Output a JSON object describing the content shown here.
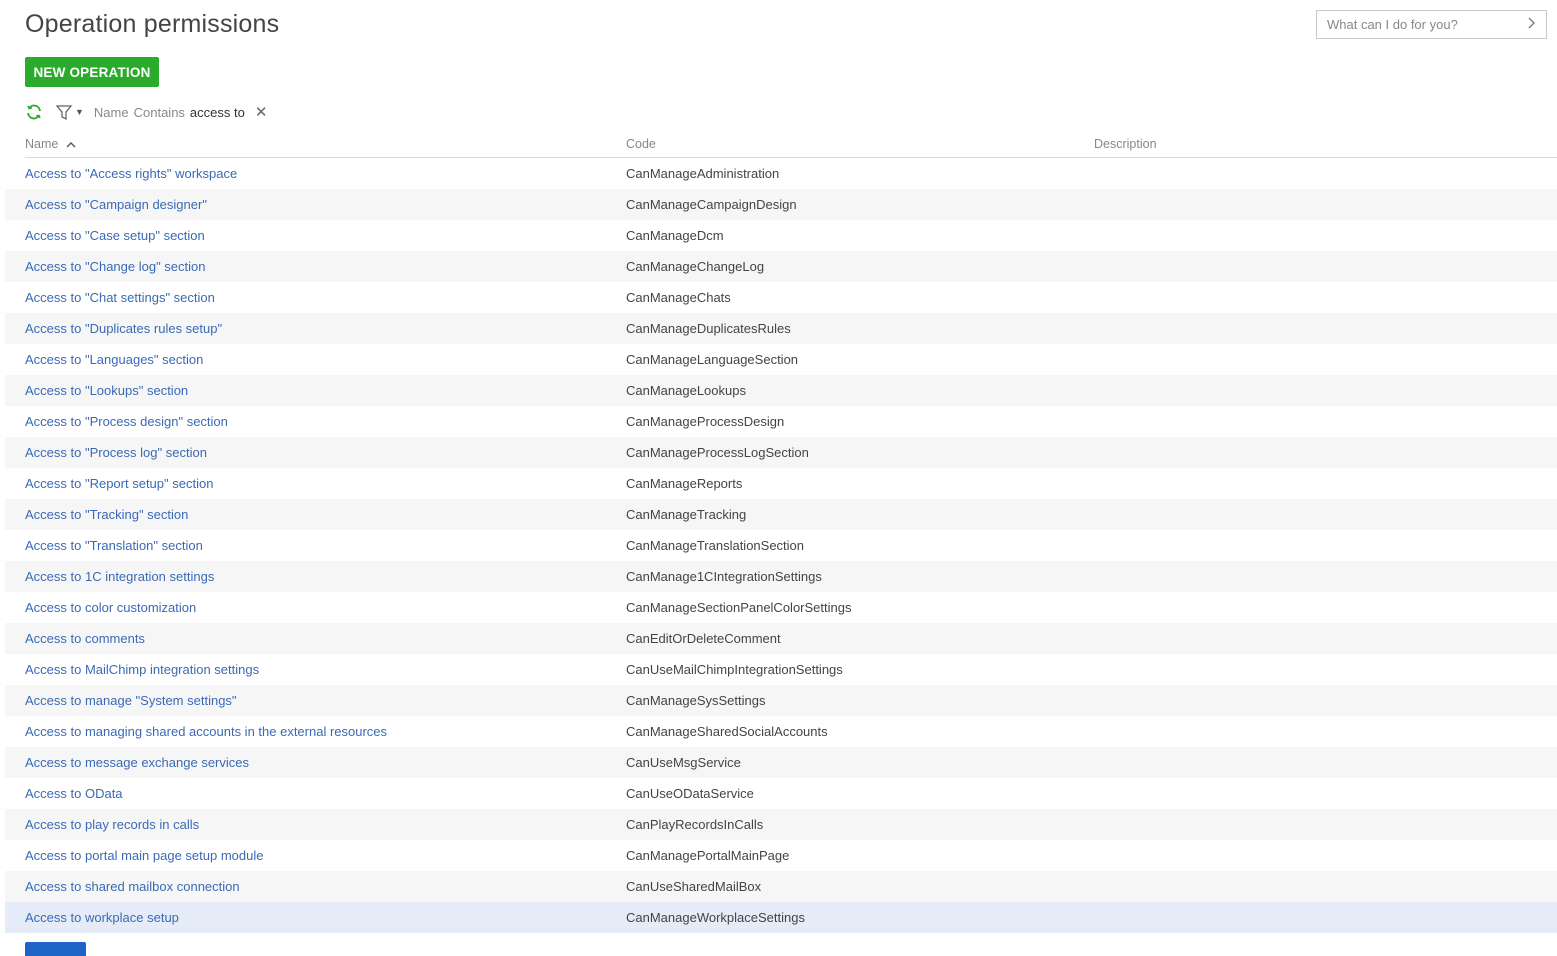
{
  "page": {
    "title": "Operation permissions"
  },
  "command": {
    "placeholder": "What can I do for you?"
  },
  "toolbar": {
    "new_label": "NEW OPERATION"
  },
  "filter": {
    "column": "Name",
    "operator": "Contains",
    "value": "access to"
  },
  "table": {
    "columns": [
      "Name",
      "Code",
      "Description"
    ],
    "rows": [
      {
        "name": "Access to \"Access rights\" workspace",
        "code": "CanManageAdministration",
        "description": ""
      },
      {
        "name": "Access to \"Campaign designer\"",
        "code": "CanManageCampaignDesign",
        "description": ""
      },
      {
        "name": "Access to \"Case setup\" section",
        "code": "CanManageDcm",
        "description": ""
      },
      {
        "name": "Access to \"Change log\" section",
        "code": "CanManageChangeLog",
        "description": ""
      },
      {
        "name": "Access to \"Chat settings\" section",
        "code": "CanManageChats",
        "description": ""
      },
      {
        "name": "Access to \"Duplicates rules setup\"",
        "code": "CanManageDuplicatesRules",
        "description": ""
      },
      {
        "name": "Access to \"Languages\" section",
        "code": "CanManageLanguageSection",
        "description": ""
      },
      {
        "name": "Access to \"Lookups\" section",
        "code": "CanManageLookups",
        "description": ""
      },
      {
        "name": "Access to \"Process design\" section",
        "code": "CanManageProcessDesign",
        "description": ""
      },
      {
        "name": "Access to \"Process log\" section",
        "code": "CanManageProcessLogSection",
        "description": ""
      },
      {
        "name": "Access to \"Report setup\" section",
        "code": "CanManageReports",
        "description": ""
      },
      {
        "name": "Access to \"Tracking\" section",
        "code": "CanManageTracking",
        "description": ""
      },
      {
        "name": "Access to \"Translation\" section",
        "code": "CanManageTranslationSection",
        "description": ""
      },
      {
        "name": "Access to 1C integration settings",
        "code": "CanManage1CIntegrationSettings",
        "description": ""
      },
      {
        "name": "Access to color customization",
        "code": "CanManageSectionPanelColorSettings",
        "description": ""
      },
      {
        "name": "Access to comments",
        "code": "CanEditOrDeleteComment",
        "description": ""
      },
      {
        "name": "Access to MailChimp integration settings",
        "code": "CanUseMailChimpIntegrationSettings",
        "description": ""
      },
      {
        "name": "Access to manage \"System settings\"",
        "code": "CanManageSysSettings",
        "description": ""
      },
      {
        "name": "Access to managing shared accounts in the external resources",
        "code": "CanManageSharedSocialAccounts",
        "description": ""
      },
      {
        "name": "Access to message exchange services",
        "code": "CanUseMsgService",
        "description": ""
      },
      {
        "name": "Access to OData",
        "code": "CanUseODataService",
        "description": ""
      },
      {
        "name": "Access to play records in calls",
        "code": "CanPlayRecordsInCalls",
        "description": ""
      },
      {
        "name": "Access to portal main page setup module",
        "code": "CanManagePortalMainPage",
        "description": ""
      },
      {
        "name": "Access to shared mailbox connection",
        "code": "CanUseSharedMailBox",
        "description": ""
      },
      {
        "name": "Access to workplace setup",
        "code": "CanManageWorkplaceSettings",
        "description": ""
      }
    ]
  },
  "icons": {
    "refresh": "refresh-icon",
    "filter": "filter-icon",
    "sort": "sort-ascending-icon",
    "close": "close-icon",
    "chevron": "chevron-right-icon"
  },
  "colors": {
    "accent_green": "#2bab2b",
    "link": "#3b6ab5",
    "selected_row": "#e5ecf8",
    "button_blue": "#1e64c8"
  }
}
